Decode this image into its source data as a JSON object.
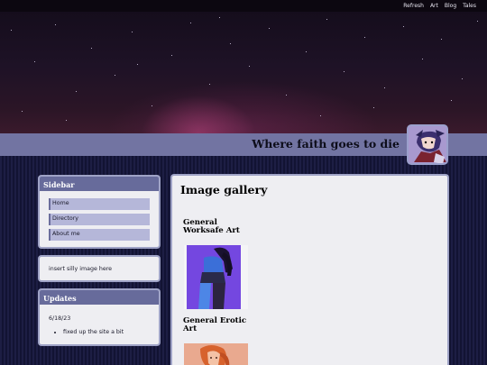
{
  "topnav": {
    "items": [
      "Refresh",
      "Art",
      "Blog",
      "Tales"
    ]
  },
  "header": {
    "site_title": "Where faith goes to die"
  },
  "sidebar": {
    "heading": "Sidebar",
    "items": [
      {
        "label": "Home"
      },
      {
        "label": "Directory"
      },
      {
        "label": "About me"
      }
    ],
    "image_box_text": "insert silly image here"
  },
  "updates": {
    "heading": "Updates",
    "date": "6/18/23",
    "entries": [
      "fixed up the site a bit"
    ]
  },
  "main": {
    "title": "Image gallery",
    "categories": [
      {
        "label": "General Worksafe Art"
      },
      {
        "label": "General Erotic Art"
      }
    ]
  },
  "colors": {
    "nav_bar": "#0c0710",
    "title_bar": "#7274a2",
    "panel_header": "#676b9b",
    "panel_bg": "#eeeef2",
    "nav_button": "#b5b7d9"
  }
}
